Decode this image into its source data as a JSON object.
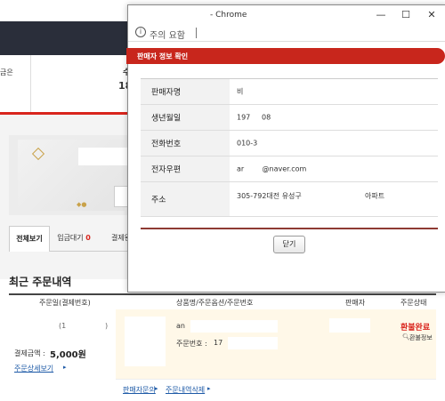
{
  "background": {
    "stats_left_text": "금은",
    "stats_mid_top": "수",
    "stats_mid_bottom": "18",
    "tabs": {
      "all": "전체보기",
      "waiting_label": "입금대기",
      "waiting_count": "0",
      "third": "결제완"
    },
    "recent_orders_title": "최근 주문내역",
    "table_headers": {
      "order_date": "주문일(결제번호)",
      "product": "상품명/주문옵션/주문번호",
      "seller": "판매자",
      "status": "주문상태"
    },
    "order": {
      "paren_open": "(1",
      "paren_close": ")",
      "amount_label": "결제금액 :",
      "amount_value": "5,000원",
      "detail_link": "주문상세보기",
      "product_name": "an",
      "order_no_label": "주문번호 :",
      "order_no_value": "17",
      "status": "환불완료",
      "refund_info": "환불정보",
      "seller_inquiry_link": "판매자문의",
      "delete_order_link": "주문내역삭제"
    }
  },
  "popup": {
    "window_title": "- Chrome",
    "address_text": "주의 요함",
    "header_title": "판매자 정보 확인",
    "rows": [
      {
        "label": "판매자명",
        "value": "비"
      },
      {
        "label": "생년월일",
        "value": "197     08"
      },
      {
        "label": "전화번호",
        "value": "010-3"
      },
      {
        "label": "전자우편",
        "value": "ar        @naver.com"
      },
      {
        "label": "주소",
        "value": "305-792대전 유성구                            아파트"
      }
    ],
    "close_button": "닫기"
  },
  "colors": {
    "accent_red": "#c8261c",
    "link_blue": "#1b58a6",
    "status_red": "#d9251d"
  }
}
